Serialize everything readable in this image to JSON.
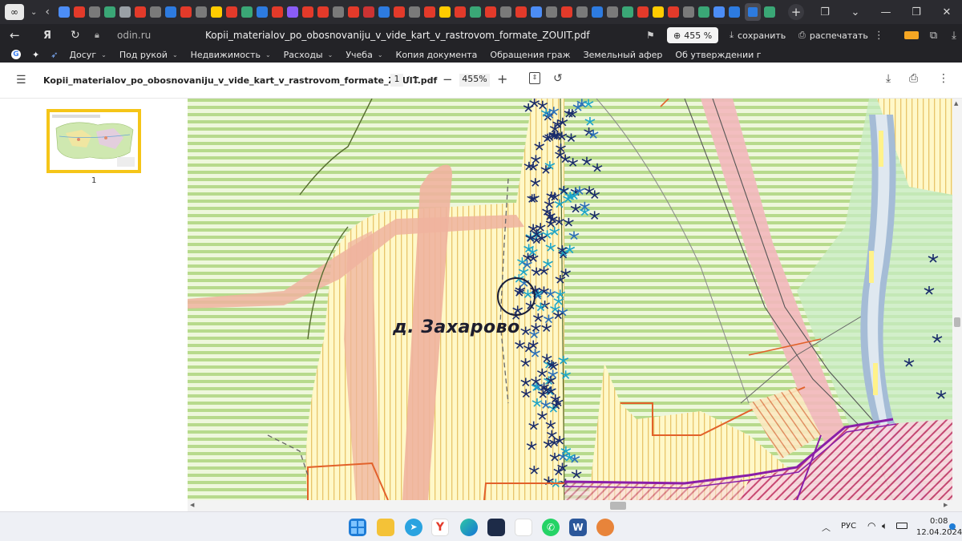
{
  "tabstrip": {
    "tab_colors": [
      "#4c8df6",
      "#e33a2a",
      "#7a7a7a",
      "#3aa776",
      "#9aa0a6",
      "#e33a2a",
      "#7a7a7a",
      "#2d7be0",
      "#e33a2a",
      "#7a7a7a",
      "#ffcc00",
      "#e33a2a",
      "#3aa776",
      "#2d7be0",
      "#e33a2a",
      "#8a5cf6",
      "#e33a2a",
      "#e33a2a",
      "#7a7a7a",
      "#e33a2a",
      "#cc3333",
      "#2d7be0",
      "#e33a2a",
      "#7a7a7a",
      "#e33a2a",
      "#ffcc00",
      "#e33a2a",
      "#3aa776",
      "#e33a2a",
      "#7a7a7a",
      "#e33a2a",
      "#4c8df6",
      "#7a7a7a",
      "#e33a2a",
      "#7a7a7a",
      "#2d7be0",
      "#7a7a7a",
      "#3aa776",
      "#e33a2a",
      "#ffcc00",
      "#e33a2a",
      "#7a7a7a",
      "#3aa776",
      "#4c8df6",
      "#2d7be0"
    ],
    "new_tab_icon": "plus-icon"
  },
  "address": {
    "domain": "odin.ru",
    "title": "Kopii_materialov_po_obosnovaniju_v_vide_kart_v_rastrovom_formate_ZOUIT.pdf",
    "zoom_badge": "455 %",
    "save_label": "сохранить",
    "print_label": "распечатать"
  },
  "bookmarks": [
    {
      "label": "Досуг",
      "chev": "⌄"
    },
    {
      "label": "Под рукой",
      "chev": "⌄"
    },
    {
      "label": "Недвижимость",
      "chev": "⌄"
    },
    {
      "label": "Расходы",
      "chev": "⌄"
    },
    {
      "label": "Учеба",
      "chev": "⌄"
    },
    {
      "label": "Копия документа",
      "chev": ""
    },
    {
      "label": "Обращения граж",
      "chev": ""
    },
    {
      "label": "Земельный афер",
      "chev": ""
    },
    {
      "label": "Об утверждении г",
      "chev": ""
    }
  ],
  "pdf": {
    "filename": "Kopii_materialov_po_obosnovaniju_v_vide_kart_v_rastrovom_formate_ZOUIT.pdf",
    "page_current": "1",
    "page_sep": "/",
    "page_total": "1",
    "zoom": "455%",
    "thumb_page_label": "1"
  },
  "map": {
    "village_label": "д. Захарово"
  },
  "taskbar": {
    "lang": "РУС",
    "time": "0:08",
    "date": "12.04.2024"
  },
  "colors": {
    "map_green_line": "#b6d98a",
    "map_yellow": "#fdf3b0",
    "map_pink": "#f0b9a9",
    "map_purple": "#9a2bb0",
    "accent_yellow_thumb": "#f5c518"
  }
}
